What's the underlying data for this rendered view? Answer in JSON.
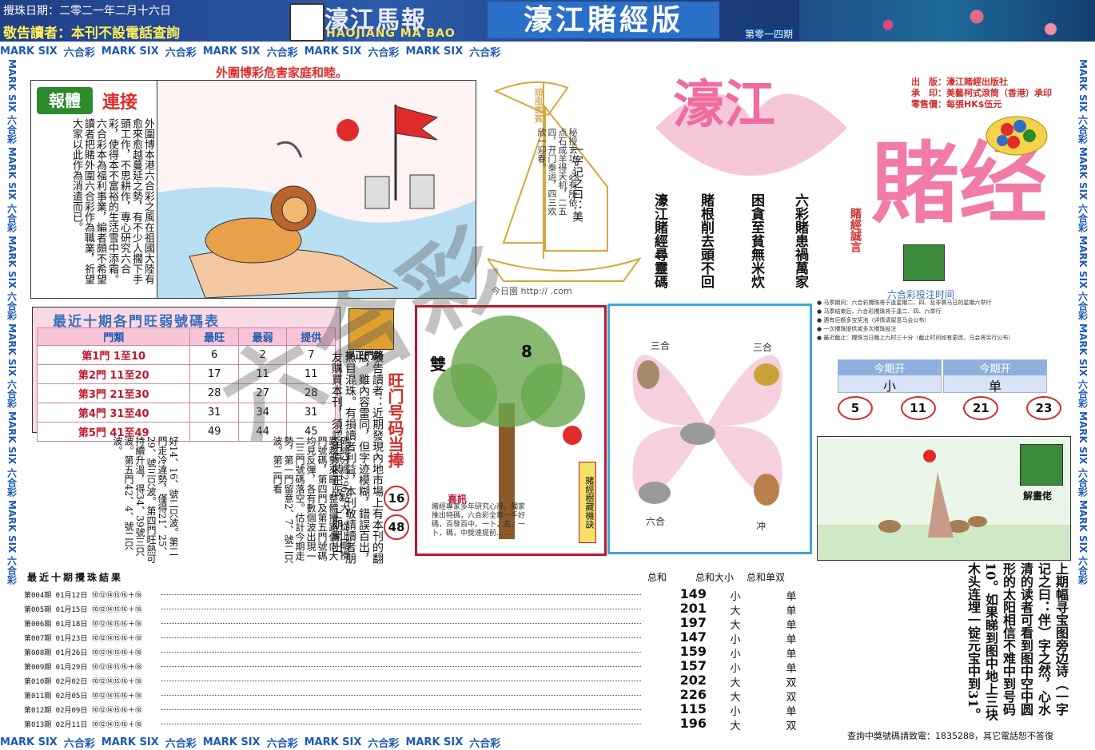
{
  "header": {
    "draw_date": "攪珠日期：二零二一年二月十六日",
    "warning": "敬告讀者：本刊不設電話查詢",
    "logo_cn": "濠江馬報",
    "logo_en": "HAOJIANG MA BAO",
    "edition": "濠江賭經版",
    "issue": "第零一四期"
  },
  "strip": {
    "label_en": "MARK SIX",
    "label_cn": "六合彩"
  },
  "article": {
    "badge": "報體",
    "title": "連接",
    "body": "外圍博本港六合彩之風在祖國大陸有愈來愈越蔓延之勢，有不少人擱下手頭工作，不思耕作，專心研究六合彩，使得本不富裕的生活雪中添霜。六合彩本為福利事業，編者頗不希望讀者把賭外圍六合彩作為職業，祈望大家以此作為消遣而已。",
    "caption": "外圍博彩危害家庭和睦。"
  },
  "ship": {
    "flag_text": "順風壽賓",
    "poem": "秘授玄功，必有所依，点石成羊得天机，二五四，开门泰运，四三欢欣一迎春。",
    "yizi": "一字记之曰：美",
    "url": "今日園 http://      .com"
  },
  "brand": {
    "big_1": "濠江",
    "big_2": "賭经",
    "slogan": "賭經誠言",
    "pub_lines": [
      "出　版：濠江賭經出版社",
      "承　印：美藝柯式滾筒（香港）承印",
      "零售價：每張HK$伍元"
    ],
    "poem_cols": [
      "六彩賭患禍萬家",
      "困貪至貧無米炊",
      "賭根削去頭不回",
      "濠江賭經尋靈碼"
    ]
  },
  "betting_time": {
    "title": "六合彩投注时间",
    "rules": [
      "● 马季期间：六合彩攪珠将于逢星期二、四、及非赛马日的星期六举行",
      "● 马季结束后，六合彩攪珠将于逢二、四、六举行",
      "● 遇有巨额多宝奖池（详情请留意马会公布）",
      "● 一次攪珠提供或多次攪珠投注",
      "● 最迟截止：攪珠当日晚上九时三十分（截止时间如有更改，马会将另行公布）"
    ],
    "tiles": [
      {
        "label": "今期开",
        "value": "小"
      },
      {
        "label": "今期开",
        "value": "单"
      }
    ],
    "ovals": [
      "5",
      "11",
      "21",
      "23"
    ]
  },
  "freq": {
    "title": "最近十期各門旺弱號碼表",
    "headers": [
      "門類",
      "最旺",
      "最弱",
      "提供"
    ],
    "rows": [
      {
        "door": "第1門",
        "range": "1至10",
        "hot": "6",
        "weak": "2",
        "offer": "7"
      },
      {
        "door": "第2門",
        "range": "11至20",
        "hot": "17",
        "weak": "11",
        "offer": "11"
      },
      {
        "door": "第3門",
        "range": "21至30",
        "hot": "28",
        "weak": "27",
        "offer": "28"
      },
      {
        "door": "第4門",
        "range": "31至40",
        "hot": "31",
        "weak": "34",
        "offer": "31"
      },
      {
        "door": "第5門",
        "range": "41至49",
        "hot": "49",
        "weak": "44",
        "offer": "45"
      }
    ]
  },
  "columns": {
    "left": "好14、16、號二只波。第二門走冷違勢，僅得21、25、29、號三只波。第四門旺熱可持續升溫，得34、39號三只波。第五門42、4、號二只波。",
    "mid": "碼總分爲296點大，從上期攪路趨勢來睇，整體攪路偏向大門號碼，第四門及第五門號碼均見反彈，各有數個波出現一二三門號碼落空。估計今期走勢，第一門留意2、7、號二只波。第二門看",
    "notice": "敬告讀者：近期發現內地市場上有本刊的翻版，雖內容雷同，但字迹模糊，錯誤百出，魚目混珠。有損讀者利益，本刊敬請讀者朋友購買本刊，須認明原裝正版。上期開出"
  },
  "zhengmen": {
    "label": "捉正門路",
    "hot_title": "旺门号码当捧",
    "nums": [
      "16",
      "48"
    ]
  },
  "tree": {
    "shuang": "雙",
    "num": "8",
    "xi_label": "喜訊",
    "xi_text": "賭經專家多年研究心得，獨家推出特碼，六合彩全靠一手好碼，百發百中。一卜，名，一卜，碼，中獎速提前……",
    "side_tag": "賭經樹藏機訣"
  },
  "zodiac": {
    "labels": [
      "三合",
      "三合",
      "六合",
      "冲"
    ]
  },
  "puzzle": {
    "label": "解畫佬",
    "text": "上期幅寻宝图旁边诗（一字记之曰：伴）字之然，心水清的读者可看到图中空中圆形的太阳相信不难中到号码10。如果睇到图中地上三块木头连埋一锭元宝中到31。"
  },
  "results": {
    "title": "最近十期攪珠結果",
    "headers": {
      "sum": "总和",
      "size": "总和大小",
      "parity": "总和单双"
    },
    "rows": [
      {
        "label": "第004期 01月12日 ⑩⑫⑭⑮⑯＋⑱",
        "sum": "149",
        "size": "小",
        "parity": "单"
      },
      {
        "label": "第005期 01月15日 ⑩⑫⑭⑮⑯＋⑱",
        "sum": "201",
        "size": "大",
        "parity": "单"
      },
      {
        "label": "第006期 01月18日 ⑩⑫⑭⑮⑯＋⑱",
        "sum": "197",
        "size": "大",
        "parity": "单"
      },
      {
        "label": "第007期 01月23日 ⑩⑫⑭⑮⑯＋⑱",
        "sum": "147",
        "size": "小",
        "parity": "单"
      },
      {
        "label": "第008期 01月26日 ⑩⑫⑭⑮⑯＋⑱",
        "sum": "159",
        "size": "小",
        "parity": "单"
      },
      {
        "label": "第009期 01月29日 ⑩⑫⑭⑮⑯＋⑱",
        "sum": "157",
        "size": "小",
        "parity": "单"
      },
      {
        "label": "第010期 02月02日 ⑩⑫⑭⑮⑯＋⑱",
        "sum": "202",
        "size": "大",
        "parity": "双"
      },
      {
        "label": "第011期 02月05日 ⑩⑫⑭⑮⑯＋⑱",
        "sum": "226",
        "size": "大",
        "parity": "双"
      },
      {
        "label": "第012期 02月09日 ⑩⑫⑭⑮⑯＋⑱",
        "sum": "115",
        "size": "小",
        "parity": "单"
      },
      {
        "label": "第013期 02月11日 ⑩⑫⑭⑮⑯＋⑱",
        "sum": "196",
        "size": "大",
        "parity": "双"
      }
    ]
  },
  "footer": {
    "contact": "查詢中獎號碼請致電：1835288，其它電話恕不答復"
  },
  "watermark": "六合彩"
}
